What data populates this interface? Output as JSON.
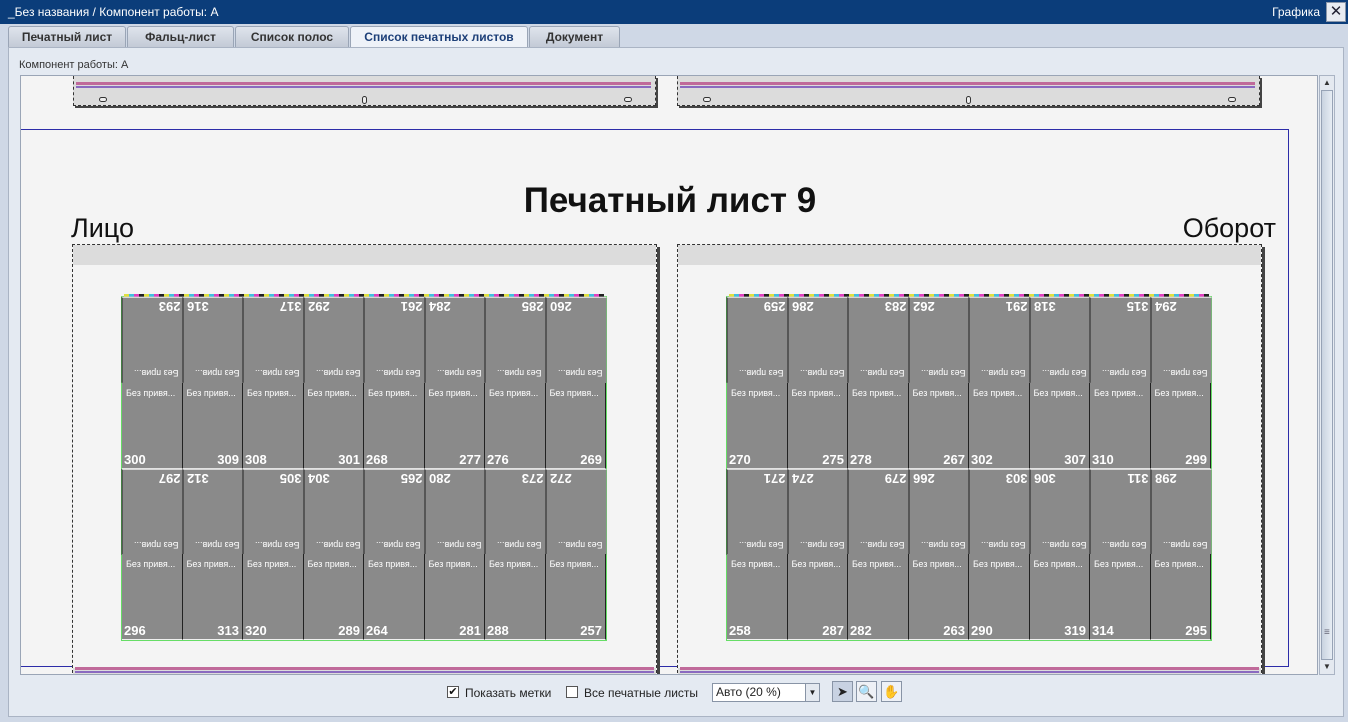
{
  "window": {
    "title": "_Без названия / Компонент работы: A",
    "right_label": "Графика",
    "close": "✕"
  },
  "tabs": [
    {
      "label": "Печатный лист",
      "active": false
    },
    {
      "label": "Фальц-лист",
      "active": false
    },
    {
      "label": "Список полос",
      "active": false
    },
    {
      "label": "Список печатных листов",
      "active": true
    },
    {
      "label": "Документ",
      "active": false
    }
  ],
  "component_label": "Компонент работы: A",
  "sheet": {
    "title": "Печатный лист 9",
    "front_label": "Лицо",
    "back_label": "Оборот",
    "page_label": "Без привя...",
    "page_label_rot": "Без прив...",
    "front_rows": [
      [
        "293",
        "316",
        "317",
        "292",
        "261",
        "284",
        "285",
        "260"
      ],
      [
        "300",
        "309",
        "308",
        "301",
        "268",
        "277",
        "276",
        "269"
      ],
      [
        "297",
        "312",
        "305",
        "304",
        "265",
        "280",
        "273",
        "272"
      ],
      [
        "296",
        "313",
        "320",
        "289",
        "264",
        "281",
        "288",
        "257"
      ]
    ],
    "back_rows": [
      [
        "259",
        "286",
        "283",
        "262",
        "291",
        "318",
        "315",
        "294"
      ],
      [
        "270",
        "275",
        "278",
        "267",
        "302",
        "307",
        "310",
        "299"
      ],
      [
        "271",
        "274",
        "279",
        "266",
        "303",
        "306",
        "311",
        "298"
      ],
      [
        "258",
        "287",
        "282",
        "263",
        "290",
        "319",
        "314",
        "295"
      ]
    ]
  },
  "bottom": {
    "show_marks_label": "Показать метки",
    "show_marks_checked": true,
    "all_sheets_label": "Все печатные листы",
    "all_sheets_checked": false,
    "zoom_value": "Авто (20 %)"
  },
  "tool_icons": [
    "select-arrow-icon",
    "zoom-icon",
    "hand-pan-icon"
  ],
  "colors": {
    "titlebar": "#0b3d7a",
    "page_fill": "#8a8a8a",
    "trim_border": "#66dd66"
  }
}
